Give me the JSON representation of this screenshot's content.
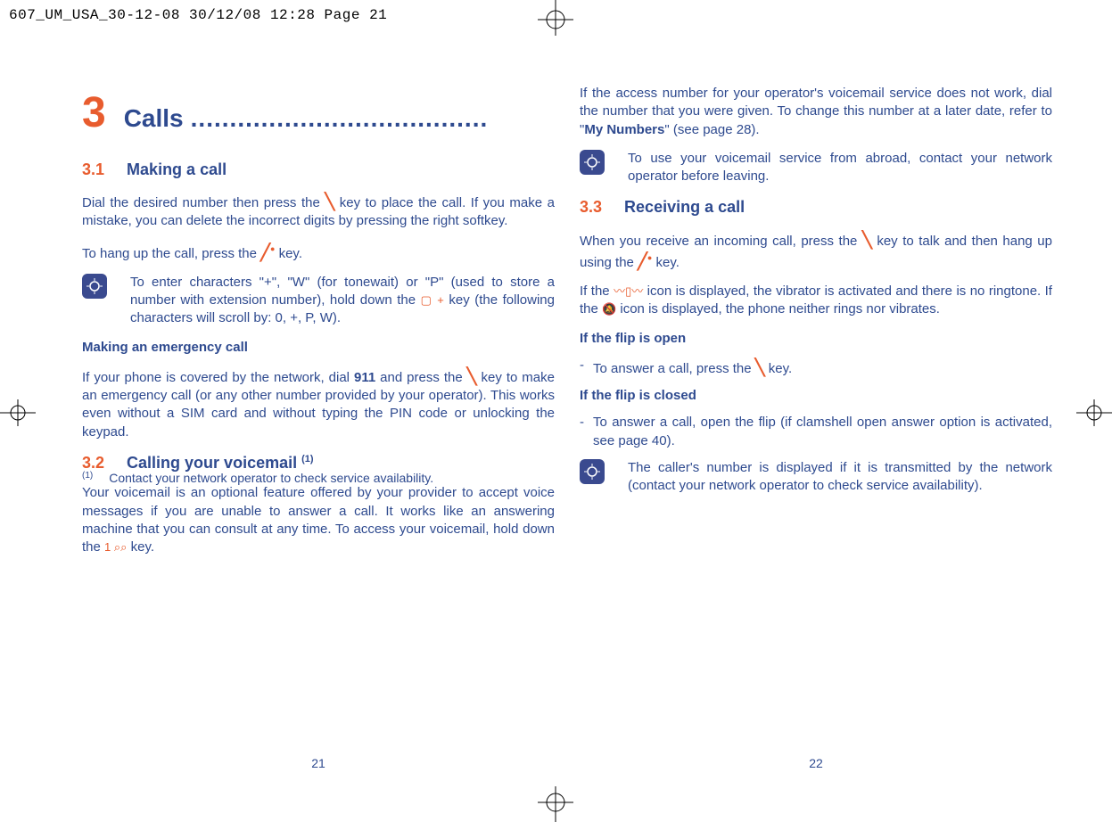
{
  "header": {
    "prepress_tag": "607_UM_USA_30-12-08  30/12/08  12:28  Page 21"
  },
  "left_page": {
    "chapter_number": "3",
    "chapter_title": "Calls",
    "dots": "......................................",
    "s31_num": "3.1",
    "s31_title": "Making a call",
    "p_dial_1": "Dial the desired number then press the ",
    "p_dial_2": " key to place the call. If you make a mistake, you can delete the incorrect digits by pressing the right softkey.",
    "p_hangup_1": "To hang up the call, press the ",
    "p_hangup_2": " key.",
    "tip1_1": "To enter characters \"+\", \"W\" (for tonewait) or \"P\" (used to store a number with extension number), hold down the ",
    "tip1_2": " key (the following characters will scroll by: 0, +, P, W).",
    "emergency_head": "Making an emergency call",
    "p_emerg_1": "If your phone is covered by the network, dial ",
    "p_emerg_bold": "911",
    "p_emerg_2": " and press the ",
    "p_emerg_3": " key to make an emergency call (or any other number provided by your operator). This works even without a SIM card and without typing the PIN code or unlocking the keypad.",
    "s32_num": "3.2",
    "s32_title": "Calling your voicemail ",
    "s32_sup": "(1)",
    "p_vm_1": "Your voicemail is an optional feature offered by your provider to accept voice messages if you are unable to answer a call. It works like an answering machine that you can consult at any time. To access your voicemail, hold down the ",
    "p_vm_2": " key.",
    "footnote_mark": "(1)",
    "footnote_text": "Contact your network operator to check service availability.",
    "page_number": "21"
  },
  "right_page": {
    "p_access_1": "If the access number for your operator's voicemail service does not work, dial the number that you were given. To change this number at a later date, refer to \"",
    "p_access_bold": "My Numbers",
    "p_access_2": "\" (see page 28).",
    "tip2": "To use your voicemail service from abroad, contact your network operator before leaving.",
    "s33_num": "3.3",
    "s33_title": "Receiving a call",
    "p_recv_1": "When you receive an incoming call, press the ",
    "p_recv_2": " key to talk and then hang up using the ",
    "p_recv_3": " key.",
    "p_icons_1": "If the ",
    "p_icons_2": " icon is displayed, the vibrator is activated and there is no ringtone. If the ",
    "p_icons_3": " icon is displayed, the phone neither rings nor vibrates.",
    "flip_open_head": "If the flip is open",
    "flip_open_bullet_1": "To answer a call, press the ",
    "flip_open_bullet_2": " key.",
    "flip_closed_head": "If the flip is closed",
    "flip_closed_bullet": "To answer a call, open the flip (if clamshell open answer option is activated, see page 40).",
    "tip3": "The caller's number is displayed if it is transmitted by the network (contact your network operator to check service availability).",
    "page_number": "22"
  }
}
